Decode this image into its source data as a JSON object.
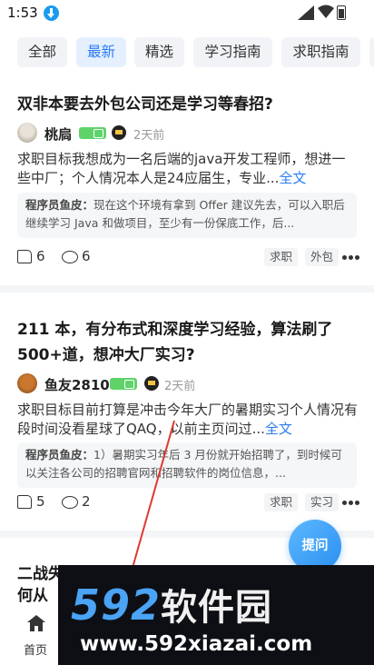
{
  "status_bar": {
    "time": "1:53",
    "icons": [
      "download-icon",
      "signal-icon",
      "wifi-icon",
      "battery-icon"
    ]
  },
  "tabs": [
    {
      "label": "全部",
      "active": false
    },
    {
      "label": "最新",
      "active": true
    },
    {
      "label": "精选",
      "active": false
    },
    {
      "label": "学习指南",
      "active": false
    },
    {
      "label": "求职指南",
      "active": false
    }
  ],
  "posts": [
    {
      "title": "双非本要去外包公司还是学习等春招?",
      "author": "桃扃",
      "time": "2天前",
      "body": "求职目标我想成为一名后端的java开发工程师，想进一些中厂；个人情况本人是24应届生，专业...",
      "more": "全文",
      "comment_author": "程序员鱼皮：",
      "comment_text": "现在这个环境有拿到 Offer 建议先去，可以入职后继续学习 Java 和做项目，至少有一份保底工作，后...",
      "likes": "6",
      "comments": "6",
      "tags": [
        "求职",
        "外包"
      ]
    },
    {
      "title": "211 本，有分布式和深度学习经验，算法刷了500+道，想冲大厂实习?",
      "author": "鱼友2810",
      "time": "2天前",
      "body": "求职目标目前打算是冲击今年大厂的暑期实习个人情况有段时间没看星球了QAQ，以前主页问过...",
      "more": "全文",
      "comment_author": "程序员鱼皮：",
      "comment_text": "1）暑期实习年后 3 月份就开始招聘了，到时候可以关注各公司的招聘官网和招聘软件的岗位信息，...",
      "likes": "5",
      "comments": "2",
      "tags": [
        "求职",
        "实习"
      ]
    }
  ],
  "next_post_title": "二战失何从",
  "ask_button": "提问",
  "bottom_nav": {
    "home_label": "首页"
  },
  "watermark": {
    "logo_num": "592",
    "logo_cn": "软件园",
    "url": "www.592xiazai.com"
  },
  "colors": {
    "accent": "#2b7cf3",
    "level_badge": "#5fd36a",
    "ask_button": "#2a8ff0",
    "watermark_bg": "#0d0f14"
  }
}
